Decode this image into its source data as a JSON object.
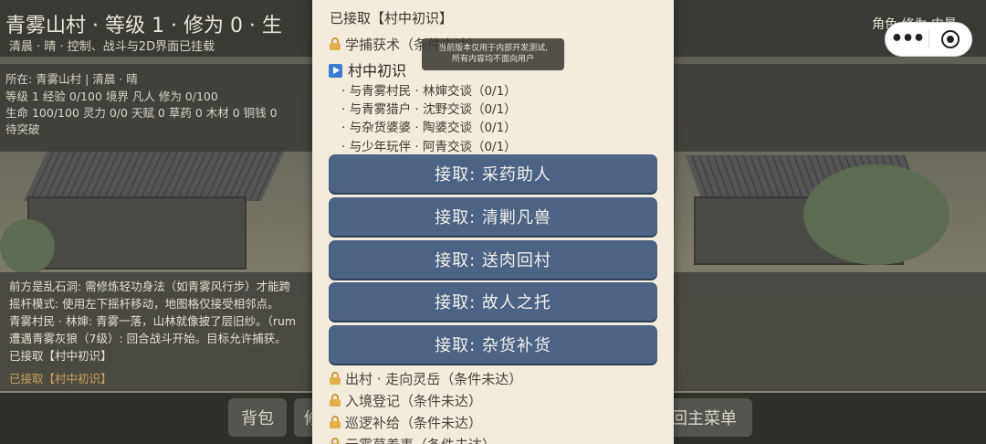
{
  "hud": {
    "title": "青雾山村 · 等级 1 · 修为 0 · 生",
    "subtitle": "清晨 · 晴 · 控制、战斗与2D界面已挂载",
    "right_links": "角色  修为  内景"
  },
  "stats": {
    "location": "所在: 青雾山村 | 清晨 · 晴",
    "level": "等级 1  经验 0/100  境界 凡人  修为 0/100",
    "resources": "生命 100/100  灵力 0/0  天赋 0  草药 0  木材 0  铜钱 0",
    "breakthrough": "待突破"
  },
  "log": {
    "lines": [
      "前方是乱石洞: 需修炼轻功身法（如青雾风行步）才能跨",
      "摇杆模式: 使用左下摇杆移动，地图格仅接受相邻点。",
      "青雾村民 · 林婶: 青雾一落，山林就像披了层旧纱。（rum",
      "遭遇青雾灰狼（7级）: 回合战斗开始。目标允许捕获。",
      "已接取【村中初识】"
    ],
    "highlight": "已接取【村中初识】"
  },
  "bottom_bar": {
    "bag": "背包",
    "second": "修",
    "main_menu": "回主菜单"
  },
  "capsule": {
    "more_icon": "more-dots-icon",
    "close_icon": "target-circle-icon"
  },
  "toast": {
    "line1": "当前版本仅用于内部开发测试,",
    "line2": "所有内容均不面向用户"
  },
  "panel": {
    "accepted_header": "已接取【村中初识】",
    "locked_top": "学捕获术（条件未达）",
    "active_quest": {
      "title": "村中初识",
      "objectives": [
        "· 与青雾村民 · 林婶交谈（0/1）",
        "· 与青雾猎户 · 沈野交谈（0/1）",
        "· 与杂货婆婆 · 陶婆交谈（0/1）",
        "· 与少年玩伴 · 阿青交谈（0/1）"
      ]
    },
    "accept_buttons": [
      "接取: 采药助人",
      "接取: 清剿凡兽",
      "接取: 送肉回村",
      "接取: 故人之托",
      "接取: 杂货补货"
    ],
    "locked_quests": [
      "出村 · 走向灵岳（条件未达）",
      "入境登记（条件未达）",
      "巡逻补给（条件未达）",
      "云雾草养事（条件未达）"
    ]
  },
  "colors": {
    "panel_bg": "#f3ecdc",
    "button_bg": "#4d6384",
    "lock_gold": "#e0b04a",
    "play_blue": "#3d7bd0",
    "log_accent": "#c9a25a"
  }
}
